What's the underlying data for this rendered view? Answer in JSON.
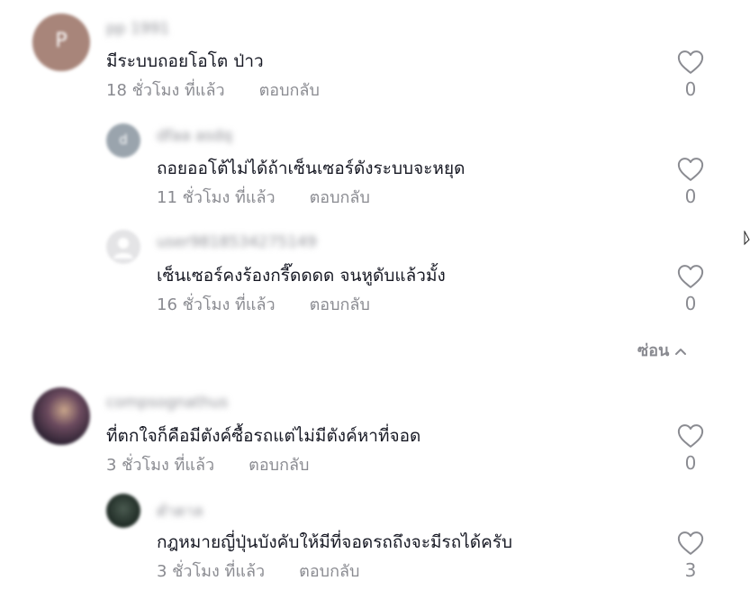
{
  "comments": [
    {
      "username": "pp 1991",
      "text": "มีระบบถอยโอโต ป่าว",
      "time": "18 ชั่วโมง ที่แล้ว",
      "reply_label": "ตอบกลับ",
      "likes": "0",
      "avatar_letter": "P",
      "avatar_color": "#a8857a"
    },
    {
      "username": "dfaa asdq",
      "text": "ถอยออโต้ไม่ได้ถ้าเซ็นเซอร์ดังระบบจะหยุด",
      "time": "11 ชั่วโมง ที่แล้ว",
      "reply_label": "ตอบกลับ",
      "likes": "0",
      "avatar_letter": "d",
      "avatar_color": "#9aa4ad"
    },
    {
      "username": "user9818534275149",
      "text": "เซ็นเซอร์คงร้องกรี๊ดดดด จนหูดับแล้วมั้ง",
      "time": "16 ชั่วโมง ที่แล้ว",
      "reply_label": "ตอบกลับ",
      "likes": "0",
      "avatar_letter": "",
      "avatar_color": "#e4e4e6"
    },
    {
      "username": "compsognathus",
      "text": "ที่ตกใจก็คือมีตังค์ซื้อรถแต่ไม่มีตังค์หาที่จอด",
      "time": "3 ชั่วโมง ที่แล้ว",
      "reply_label": "ตอบกลับ",
      "likes": "0",
      "avatar_letter": "",
      "avatar_color": "#4a3a4e"
    },
    {
      "username": "ตำตาล",
      "text": "กฎหมายญี่ปุ่นบังคับให้มีที่จอดรถถึงจะมีรถได้ครับ",
      "time": "3 ชั่วโมง ที่แล้ว",
      "reply_label": "ตอบกลับ",
      "likes": "3",
      "avatar_letter": "",
      "avatar_color": "#2c3a32"
    }
  ],
  "hide_replies_label": "ซ่อน",
  "icons": {
    "like": "heart-outline-icon",
    "collapse": "chevron-up-icon"
  },
  "colors": {
    "text_primary": "#161823",
    "text_secondary": "#8a8b91"
  }
}
